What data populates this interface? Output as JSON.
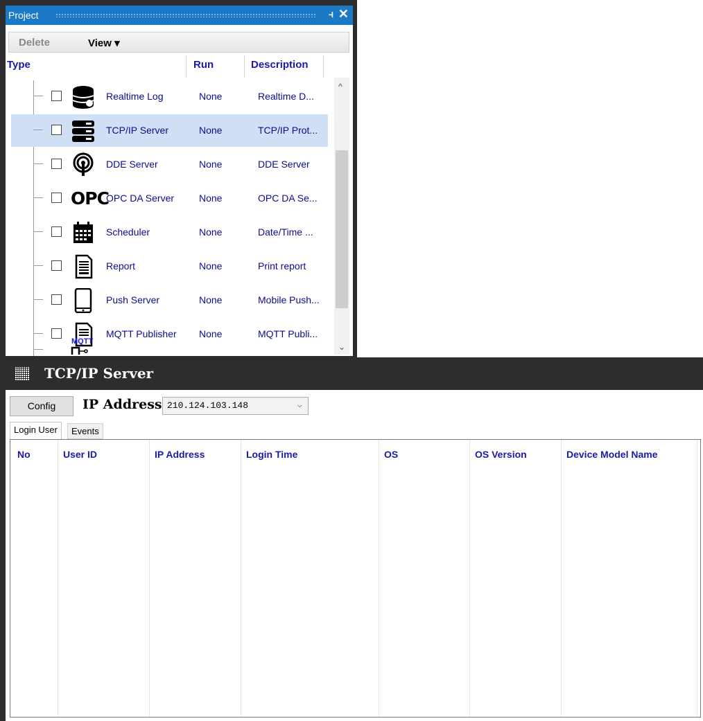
{
  "project_panel": {
    "title": "Project",
    "pin_icon": "pin-icon",
    "close_icon": "close-icon",
    "toolbar": {
      "delete_label": "Delete",
      "view_label": "View ▾"
    },
    "headers": {
      "type": "Type",
      "run": "Run",
      "description": "Description"
    },
    "rows": [
      {
        "name": "Realtime Log",
        "run": "None",
        "description": "Realtime D...",
        "icon": "database-icon"
      },
      {
        "name": "TCP/IP Server",
        "run": "None",
        "description": "TCP/IP Prot...",
        "icon": "server-icon"
      },
      {
        "name": "DDE Server",
        "run": "None",
        "description": "DDE Server",
        "icon": "broadcast-icon"
      },
      {
        "name": "OPC DA Server",
        "run": "None",
        "description": "OPC DA Se...",
        "icon": "opc-icon",
        "icon_text": "OPC"
      },
      {
        "name": "Scheduler",
        "run": "None",
        "description": "Date/Time ...",
        "icon": "calendar-icon"
      },
      {
        "name": "Report",
        "run": "None",
        "description": "Print report",
        "icon": "document-icon"
      },
      {
        "name": "Push Server",
        "run": "None",
        "description": "Mobile Push...",
        "icon": "tablet-icon"
      },
      {
        "name": "MQTT Publisher",
        "run": "None",
        "description": "MQTT Publi...",
        "icon": "mqtt-icon",
        "icon_text": "MQTT"
      }
    ],
    "selected_row": "TCP/IP Server"
  },
  "server_panel": {
    "title": "TCP/IP Server",
    "config_label": "Config",
    "ip_label": "IP Address",
    "ip_value": "210.124.103.148",
    "tabs": [
      "Login User",
      "Events"
    ],
    "active_tab": "Login User",
    "columns": [
      "No",
      "User ID",
      "IP Address",
      "Login Time",
      "OS",
      "OS Version",
      "Device Model Name"
    ]
  },
  "colors": {
    "title_bar": "#1c79c5",
    "dark_bg": "#2d2d30",
    "header_text": "#1a1aa8",
    "selection": "#cfdff6"
  }
}
